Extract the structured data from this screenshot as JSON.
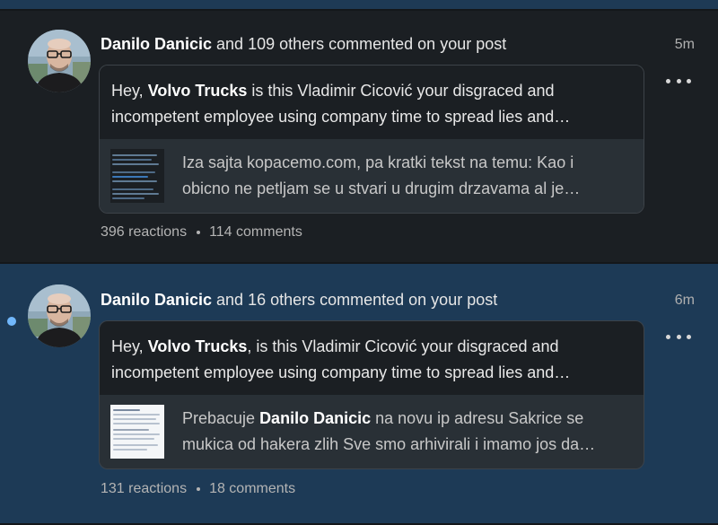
{
  "notifications": [
    {
      "actor": "Danilo Danicic",
      "action": " and 109 others commented on your post",
      "time": "5m",
      "post_prefix": "Hey, ",
      "post_company": "Volvo Trucks",
      "post_rest": " is this Vladimir Cicović your disgraced and",
      "post_line2": "incompetent employee using company time to spread lies and…",
      "shared_line1": "Iza sajta kopacemo.com, pa kratki tekst na temu: Kao i",
      "shared_line2": "obicno ne petljam se u stvari u drugim drzavama al je…",
      "reactions": "396 reactions",
      "comments": "114 comments",
      "unread": false
    },
    {
      "actor": "Danilo Danicic",
      "action": " and 16 others commented on your post",
      "time": "6m",
      "post_prefix": "Hey, ",
      "post_company": "Volvo Trucks",
      "post_rest": ", is this Vladimir Cicović your disgraced and",
      "post_line2": "incompetent employee using company time to spread lies and…",
      "shared_prefix": "Prebacuje ",
      "shared_name": "Danilo Danicic",
      "shared_rest": " na novu ip adresu Sakrice se",
      "shared_line2": "mukica od hakera zlih Sve smo arhivirali i imamo jos da…",
      "reactions": "131 reactions",
      "comments": "18 comments",
      "unread": true
    }
  ],
  "icons": {
    "more": "more-options-icon",
    "avatar": "profile-photo",
    "unread": "unread-indicator"
  },
  "colors": {
    "read_bg": "#1b1f23",
    "unread_bg": "#1d3a56",
    "unread_dot": "#71b7fb"
  }
}
